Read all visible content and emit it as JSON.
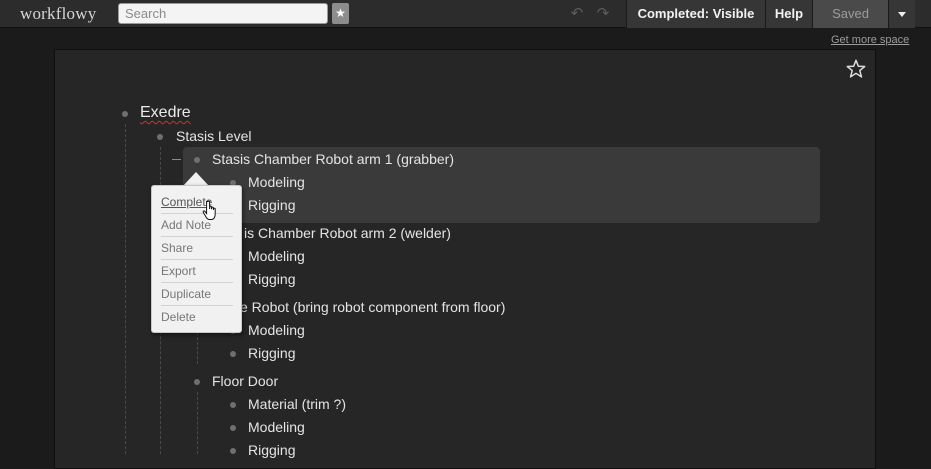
{
  "app": {
    "logo": "workflowy"
  },
  "search": {
    "placeholder": "Search"
  },
  "toolbar": {
    "star_icon": "star-icon",
    "undo_icon": "undo-icon",
    "redo_icon": "redo-icon",
    "completed_label": "Completed: Visible",
    "help_label": "Help",
    "saved_label": "Saved"
  },
  "links": {
    "get_more_space": "Get more space"
  },
  "outline": {
    "root": "Exedre",
    "level": "Stasis Level",
    "arm1": "Stasis Chamber Robot arm 1 (grabber)",
    "arm1_modeling": "Modeling",
    "arm1_rigging": "Rigging",
    "arm2": "is Chamber Robot arm 2 (welder)",
    "arm2_modeling": "Modeling",
    "arm2_rigging": "Rigging",
    "robot": "e Robot (bring robot component from floor)",
    "robot_modeling": "Modeling",
    "robot_rigging": "Rigging",
    "floor_door": "Floor Door",
    "door_material": "Material (trim ?)",
    "door_modeling": "Modeling",
    "door_rigging": "Rigging"
  },
  "context_menu": {
    "items": [
      "Complete",
      "Add Note",
      "Share",
      "Export",
      "Duplicate",
      "Delete"
    ]
  },
  "colors": {
    "highlight": "#3a3a3a",
    "background": "#262626"
  }
}
